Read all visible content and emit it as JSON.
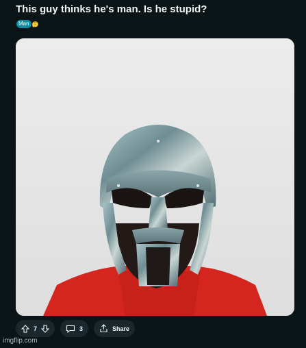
{
  "post": {
    "title": "This guy thinks he's man. Is he stupid?",
    "flair": "Man",
    "flair_emoji": "🤔"
  },
  "actions": {
    "vote_count": "7",
    "comment_count": "3",
    "share_label": "Share"
  },
  "watermark": "imgflip.com",
  "colors": {
    "background": "#0b1416",
    "flair": "#0d8da3",
    "action_pill": "#1a282d",
    "shirt": "#d4261e"
  },
  "icons": [
    "upvote-icon",
    "downvote-icon",
    "comment-icon",
    "share-icon"
  ]
}
